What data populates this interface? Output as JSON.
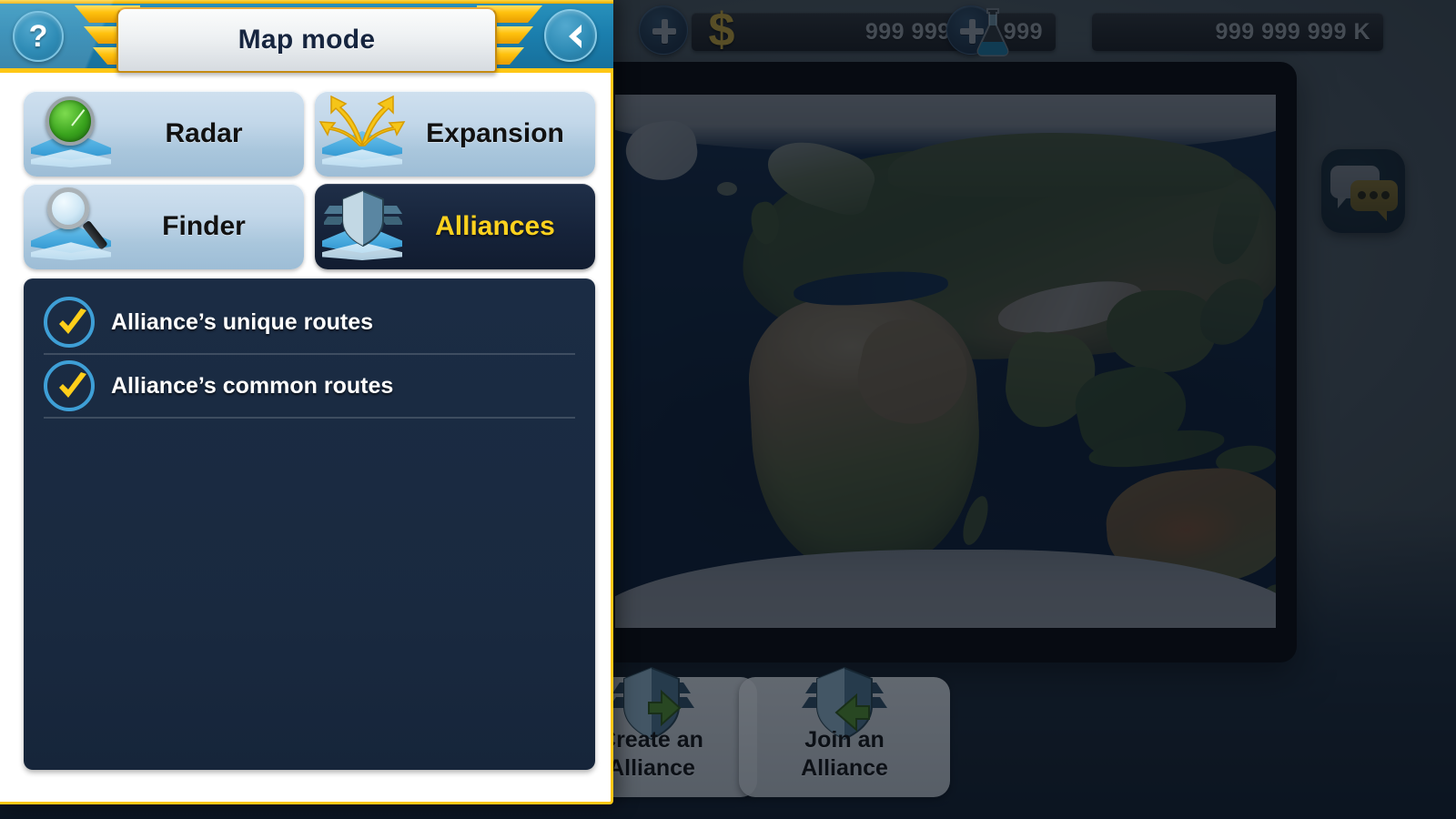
{
  "topbar": {
    "money_value": "999 999 999 999",
    "money_icon": "dollar-icon",
    "research_value": "999 999 999 K",
    "research_icon": "flask-icon",
    "add_money_label": "+",
    "add_research_label": "+"
  },
  "chat_widget": {
    "icon": "chat-bubbles-icon",
    "dots": "..."
  },
  "dialog": {
    "title": "Map mode",
    "help_label": "?",
    "back_icon": "chevron-left-icon",
    "modes": [
      {
        "key": "radar",
        "label": "Radar",
        "icon": "radar-map-icon",
        "active": false
      },
      {
        "key": "expansion",
        "label": "Expansion",
        "icon": "expansion-map-icon",
        "active": false
      },
      {
        "key": "finder",
        "label": "Finder",
        "icon": "finder-map-icon",
        "active": false
      },
      {
        "key": "alliances",
        "label": "Alliances",
        "icon": "alliance-shield-map-icon",
        "active": true
      }
    ],
    "options": [
      {
        "label": "Alliance’s unique routes",
        "checked": true
      },
      {
        "label": "Alliance’s common routes",
        "checked": true
      }
    ]
  },
  "bottom_actions": [
    {
      "key": "create",
      "label": "Create an\nAlliance",
      "line1": "Create an",
      "line2": "Alliance",
      "icon": "shield-plus-icon"
    },
    {
      "key": "join",
      "label": "Join an\nAlliance",
      "line1": "Join an",
      "line2": "Alliance",
      "icon": "shield-arrow-icon"
    }
  ],
  "colors": {
    "accent_gold": "#ffc715",
    "banner_blue": "#1b7fae",
    "panel_navy": "#1b2c44",
    "active_label": "#ffd21e",
    "check_ring": "#3e9fd6",
    "check_mark": "#ffcf1a"
  },
  "map": {
    "type": "world-satellite",
    "region": "Eastern Hemisphere"
  }
}
